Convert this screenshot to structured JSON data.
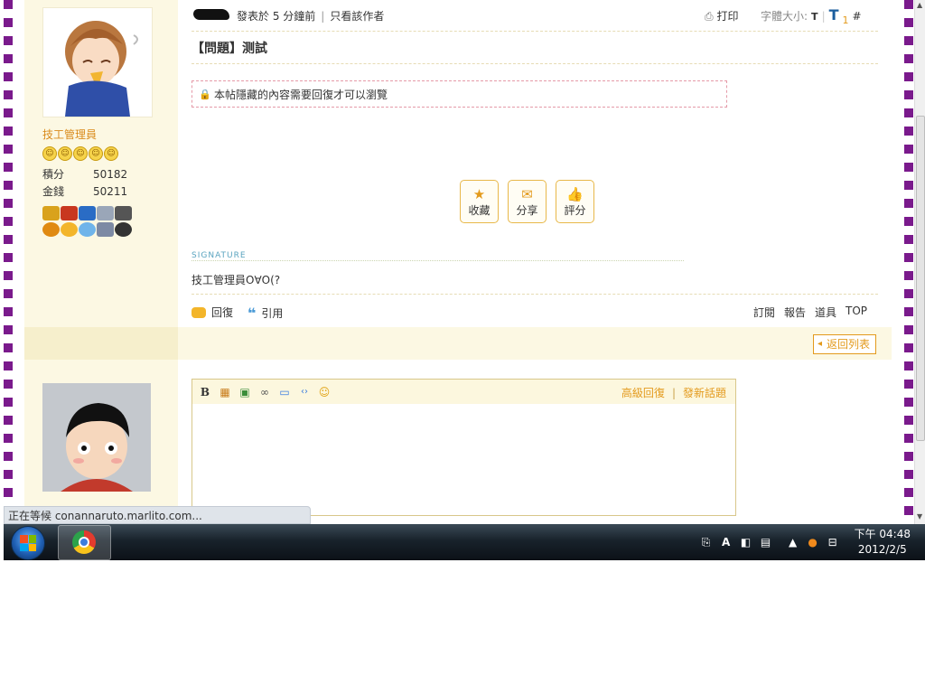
{
  "post": {
    "posted_label": "發表於",
    "posted_time": "5 分鐘前",
    "only_author": "只看該作者",
    "print_label": "打印",
    "font_size_label": "字體大小:",
    "font_small": "T",
    "font_large": "T",
    "font_num": "1",
    "hash": "#",
    "title": "【問題】测試",
    "hidden_notice": "本帖隱藏的內容需要回復才可以瀏覽",
    "actions": [
      {
        "icon": "star-icon",
        "glyph": "★",
        "label": "收藏"
      },
      {
        "icon": "envelope-icon",
        "glyph": "✉",
        "label": "分享"
      },
      {
        "icon": "thumbs-up-icon",
        "glyph": "👍",
        "label": "評分"
      }
    ],
    "signature_label": "SIGNATURE",
    "signature_text": "技工管理員O∀O(?",
    "reply_label": "回復",
    "quote_label": "引用",
    "right_links": [
      "訂閱",
      "報告",
      "道具",
      "TOP"
    ]
  },
  "author": {
    "rank": "技工管理員",
    "stars": 5,
    "points_label": "積分",
    "points": "50182",
    "money_label": "金錢",
    "money": "50211"
  },
  "nav": {
    "back_label": "返回列表"
  },
  "editor": {
    "toolbar": [
      {
        "name": "bold-button",
        "glyph": "B"
      },
      {
        "name": "color-button",
        "glyph": "▦"
      },
      {
        "name": "image-button",
        "glyph": "▣"
      },
      {
        "name": "link-button",
        "glyph": "∞"
      },
      {
        "name": "quote-button",
        "glyph": "▭"
      },
      {
        "name": "code-button",
        "glyph": "‹›"
      },
      {
        "name": "smiley-button",
        "glyph": "☺"
      }
    ],
    "advanced_reply": "高級回復",
    "new_topic": "發新話題"
  },
  "browser": {
    "status": "正在等候 conannaruto.marlito.com..."
  },
  "taskbar": {
    "clock_time": "下午 04:48",
    "clock_date": "2012/2/5"
  },
  "colors": {
    "accent": "#e39a1c",
    "border_purple": "#7a1a8c",
    "panel_bg": "#fcf8e3"
  }
}
